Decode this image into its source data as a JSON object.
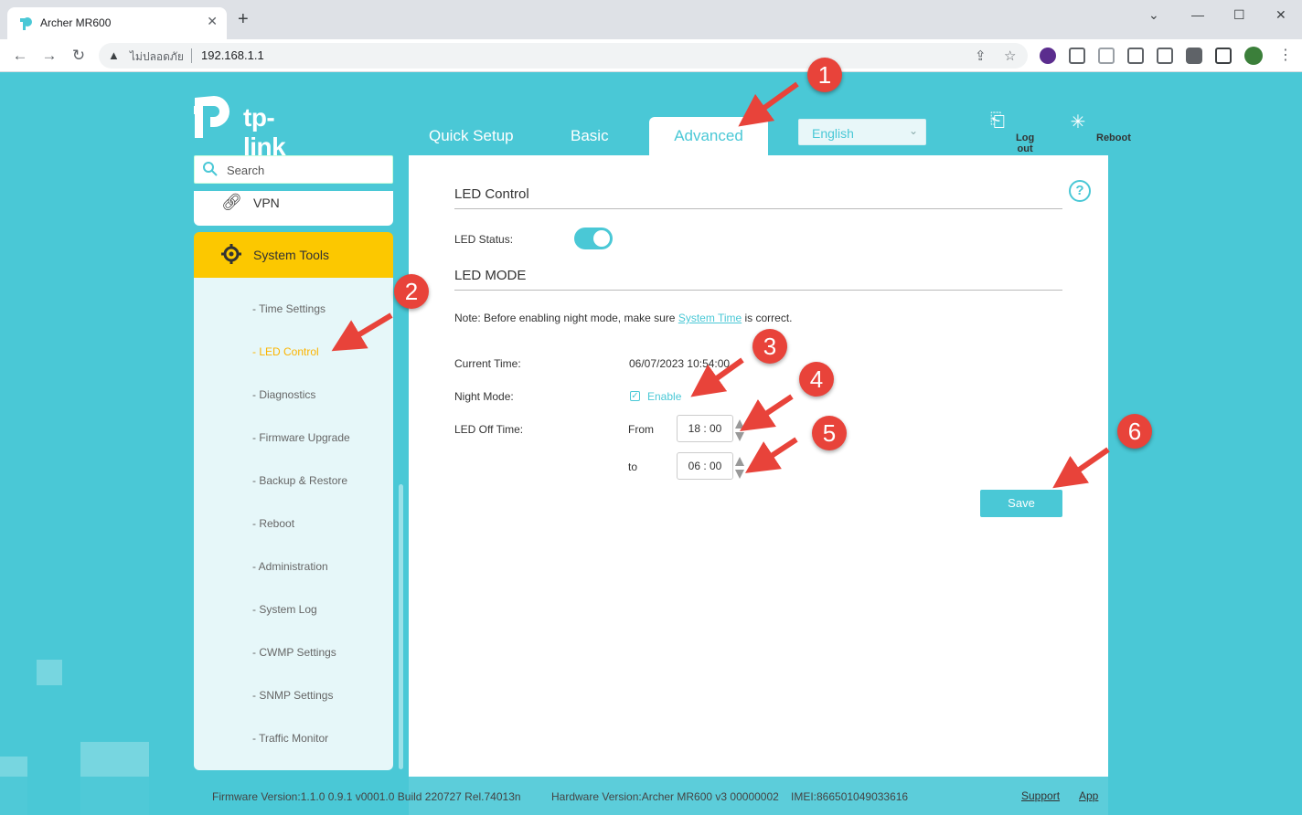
{
  "browser": {
    "tab_title": "Archer MR600",
    "security_label": "ไม่ปลอดภัย",
    "url": "192.168.1.1"
  },
  "router": {
    "brand": "tp-link",
    "nav": {
      "quick_setup": "Quick Setup",
      "basic": "Basic",
      "advanced": "Advanced",
      "language": "English",
      "logout": "Log out",
      "reboot": "Reboot"
    },
    "sidebar": {
      "search_placeholder": "Search",
      "vpn": "VPN",
      "system_tools": "System Tools",
      "items": [
        "- Time Settings",
        "- LED Control",
        "- Diagnostics",
        "- Firmware Upgrade",
        "- Backup & Restore",
        "- Reboot",
        "- Administration",
        "- System Log",
        "- CWMP Settings",
        "- SNMP Settings",
        "- Traffic Monitor"
      ],
      "active_index": 1
    },
    "content": {
      "section1_title": "LED Control",
      "led_status_label": "LED Status:",
      "led_status_on": true,
      "section2_title": "LED MODE",
      "note_prefix": "Note: Before enabling night mode, make sure ",
      "note_link": "System Time",
      "note_suffix": " is correct.",
      "current_time_label": "Current Time:",
      "current_time_value": "06/07/2023 10:54:00",
      "night_mode_label": "Night Mode:",
      "night_mode_enable": "Enable",
      "night_mode_checked": true,
      "led_off_label": "LED Off Time:",
      "from_label": "From",
      "from_value": "18 : 00",
      "to_label": "to",
      "to_value": "06 : 00",
      "save_label": "Save",
      "help_glyph": "?"
    },
    "footer": {
      "firmware": "Firmware Version:1.1.0 0.9.1 v0001.0 Build 220727 Rel.74013n",
      "hardware": "Hardware Version:Archer MR600 v3 00000002",
      "imei": "IMEI:866501049033616",
      "support": "Support",
      "app": "App"
    }
  },
  "annotations": [
    "1",
    "2",
    "3",
    "4",
    "5",
    "6"
  ],
  "colors": {
    "accent": "#4ac8d6",
    "highlight": "#fcc800",
    "annotation": "#e8433a"
  }
}
